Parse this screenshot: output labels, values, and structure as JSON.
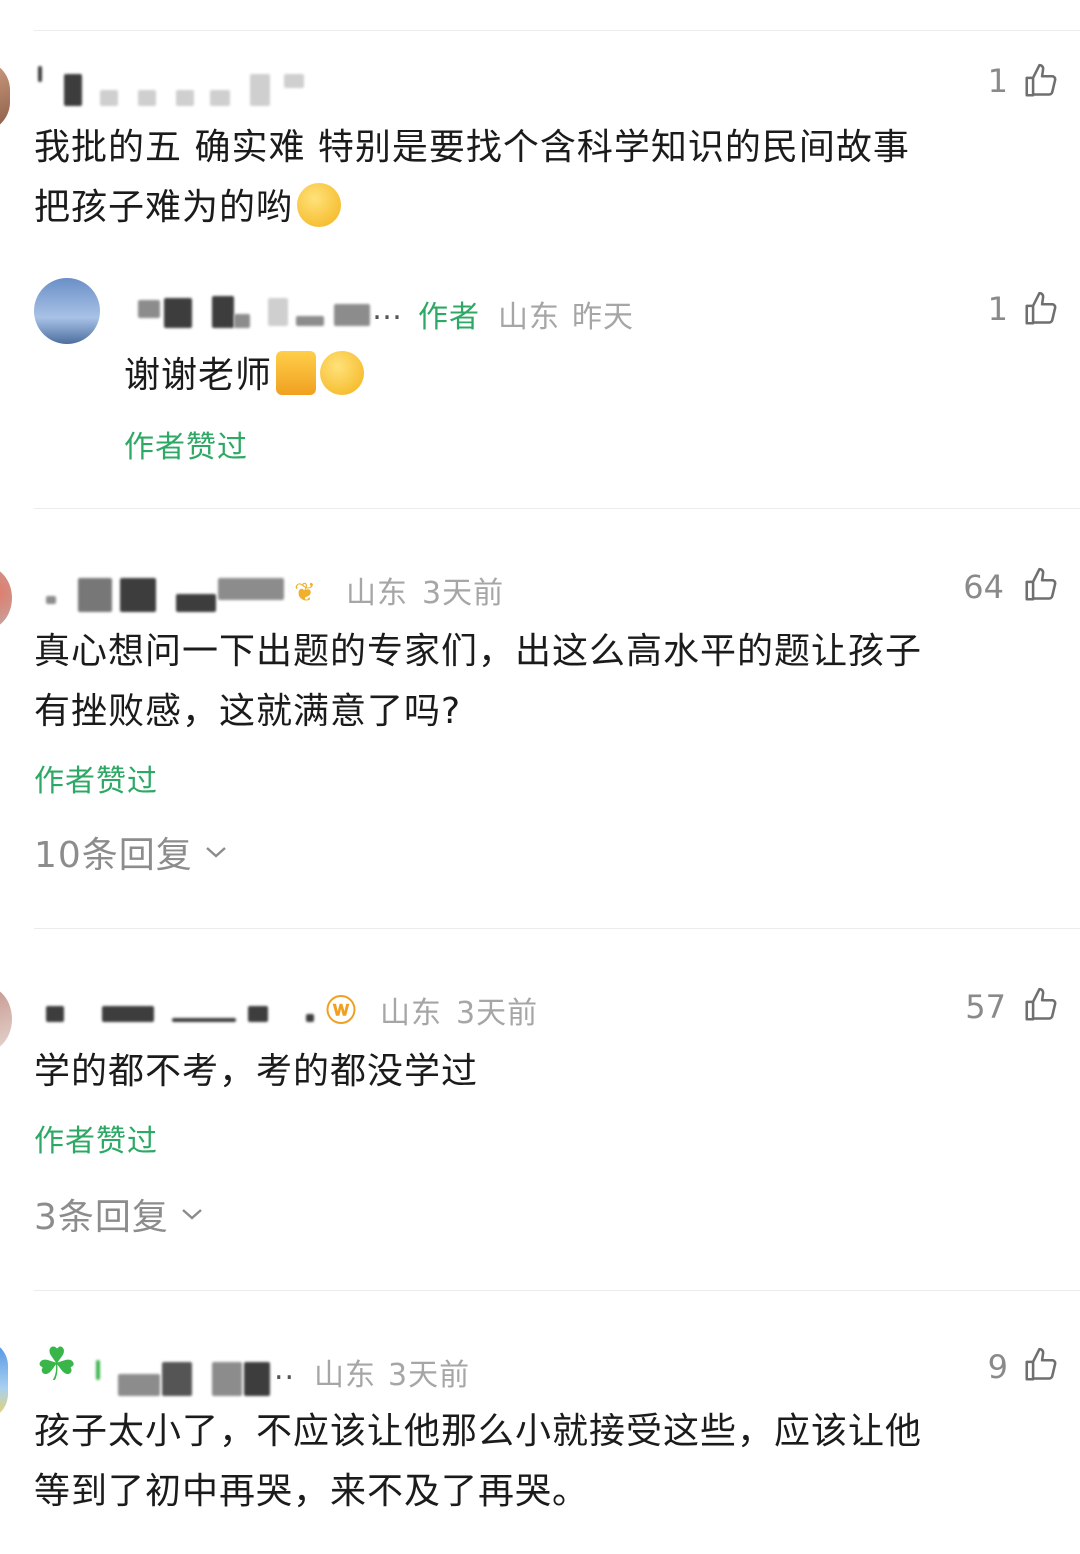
{
  "comments": [
    {
      "likes": "1",
      "text_lines": [
        "我批的五 确实难 特别是要找个含科学知识的民间故事",
        "把孩子难为的哟"
      ],
      "emoji": "facepalm-laugh-emoji",
      "reply": {
        "name_suffix": "…",
        "author_tag": "作者",
        "location": "山东",
        "time": "昨天",
        "likes": "1",
        "text": "谢谢老师",
        "liked_by_author": "作者赞过"
      }
    },
    {
      "location": "山东",
      "time": "3天前",
      "likes": "64",
      "text_lines": [
        "真心想问一下出题的专家们，出这么高水平的题让孩子",
        "有挫败感，这就满意了吗?"
      ],
      "liked_by_author": "作者赞过",
      "replies": "10条回复"
    },
    {
      "location": "山东",
      "time": "3天前",
      "likes": "57",
      "text_lines": [
        "学的都不考，考的都没学过"
      ],
      "liked_by_author": "作者赞过",
      "replies": "3条回复"
    },
    {
      "location": "山东",
      "time": "3天前",
      "likes": "9",
      "name_suffix": "..",
      "text_lines": [
        "孩子太小了，不应该让他那么小就接受这些，应该让他",
        "等到了初中再哭，来不及了再哭。"
      ]
    }
  ],
  "colors": {
    "accent_green": "#2ea865",
    "meta_gray": "#a6a6a6",
    "text": "#1b1b1b"
  }
}
